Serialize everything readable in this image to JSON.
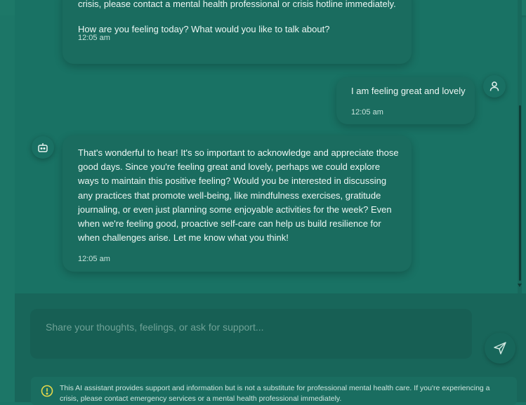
{
  "messages": [
    {
      "role": "assistant",
      "lines": [
        "crisis, please contact a mental health professional or crisis hotline immediately.",
        "How are you feeling today? What would you like to talk about?"
      ],
      "time": "12:05 am"
    },
    {
      "role": "user",
      "text": "I am feeling great and lovely",
      "time": "12:05 am"
    },
    {
      "role": "assistant",
      "text": "That's wonderful to hear! It's so important to acknowledge and appreciate those good days. Since you're feeling great and lovely, perhaps we could explore ways to maintain this positive feeling? Would you be interested in discussing any practices that promote well-being, like mindfulness exercises, gratitude journaling, or even just planning some enjoyable activities for the week? Even when we're feeling good, proactive self-care can help us build resilience for when challenges arise. Let me know what you think!",
      "time": "12:05 am"
    }
  ],
  "input": {
    "placeholder": "Share your thoughts, feelings, or ask for support...",
    "value": ""
  },
  "disclaimer": "This AI assistant provides support and information but is not a substitute for professional mental health care. If you're experiencing a crisis, please contact emergency services or a mental health professional immediately.",
  "icons": {
    "user_avatar": "user-icon",
    "bot_avatar": "bot-icon",
    "send": "send-icon",
    "warning": "warning-circle-icon"
  },
  "colors": {
    "background": "#1a7466",
    "bubble": "#1a6c5f",
    "warning": "#e6d94a"
  }
}
